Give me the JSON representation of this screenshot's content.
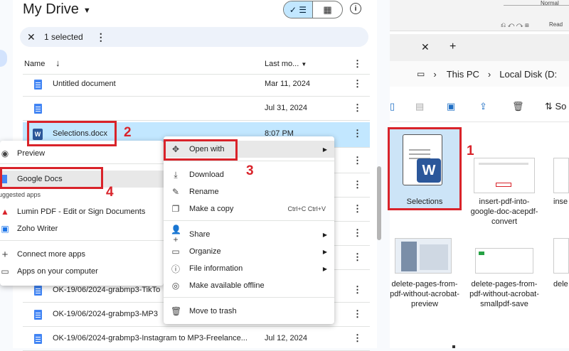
{
  "drive": {
    "title": "My Drive",
    "selection_count": "1 selected",
    "columns": {
      "name": "Name",
      "last_modified": "Last mo..."
    },
    "rows": [
      {
        "name": "Untitled document",
        "date": "Mar 11, 2024",
        "icon": "docs-icon"
      },
      {
        "name": "",
        "date": "Jul 31, 2024",
        "icon": "docs-icon"
      },
      {
        "name": "Selections.docx",
        "date": "8:07 PM",
        "icon": "word-icon"
      },
      {
        "name": "",
        "date": "",
        "icon": "docs-icon"
      },
      {
        "name": "",
        "date": "",
        "icon": "docs-icon"
      },
      {
        "name": "",
        "date": "",
        "icon": "docs-icon"
      },
      {
        "name": "",
        "date": "",
        "icon": "docs-icon"
      },
      {
        "name": "",
        "date": "",
        "icon": "docs-icon"
      },
      {
        "name": "OK-19/06/2024-grabmp3-TikTo",
        "date": "",
        "icon": "docs-icon"
      },
      {
        "name": "OK-19/06/2024-grabmp3-MP3",
        "date": "",
        "icon": "docs-icon"
      },
      {
        "name": "OK-19/06/2024-grabmp3-Instagram to MP3-Freelance...",
        "date": "Jul 12, 2024",
        "icon": "docs-icon"
      }
    ]
  },
  "context_menu": {
    "items": [
      {
        "label": "Open with",
        "icon": "move-icon",
        "submenu": true
      },
      {
        "label": "Download",
        "icon": "download-icon"
      },
      {
        "label": "Rename",
        "icon": "edit-icon"
      },
      {
        "label": "Make a copy",
        "icon": "copy-icon",
        "shortcut": "Ctrl+C Ctrl+V"
      },
      {
        "label": "Share",
        "icon": "share-icon",
        "submenu": true
      },
      {
        "label": "Organize",
        "icon": "folder-icon",
        "submenu": true
      },
      {
        "label": "File information",
        "icon": "info-icon",
        "submenu": true
      },
      {
        "label": "Make available offline",
        "icon": "offline-icon"
      },
      {
        "label": "Move to trash",
        "icon": "trash-icon"
      }
    ]
  },
  "open_with_menu": {
    "preview": "Preview",
    "google_docs": "Google Docs",
    "suggested_label": "Suggested apps",
    "lumin": "Lumin PDF - Edit or Sign Documents",
    "zoho": "Zoho Writer",
    "connect": "Connect more apps",
    "computer": "Apps on your computer"
  },
  "steps": [
    "1",
    "2",
    "3",
    "4"
  ],
  "explorer": {
    "ruler_label": "Normal",
    "read_label": "Read",
    "breadcrumb": [
      "This PC",
      "Local Disk (D:"
    ],
    "sort_label": "So",
    "files": [
      {
        "name": "Selections"
      },
      {
        "name": "insert-pdf-into-google-doc-acepdf-convert"
      },
      {
        "name": "inse"
      },
      {
        "name": "delete-pages-from-pdf-without-acrobat-preview"
      },
      {
        "name": "delete-pages-from-pdf-without-acrobat-smallpdf-save"
      },
      {
        "name": "dele"
      }
    ]
  },
  "colors": {
    "accent": "#d9232a",
    "selection": "#c2e7ff",
    "word": "#2b579a",
    "docs": "#4285f4"
  }
}
